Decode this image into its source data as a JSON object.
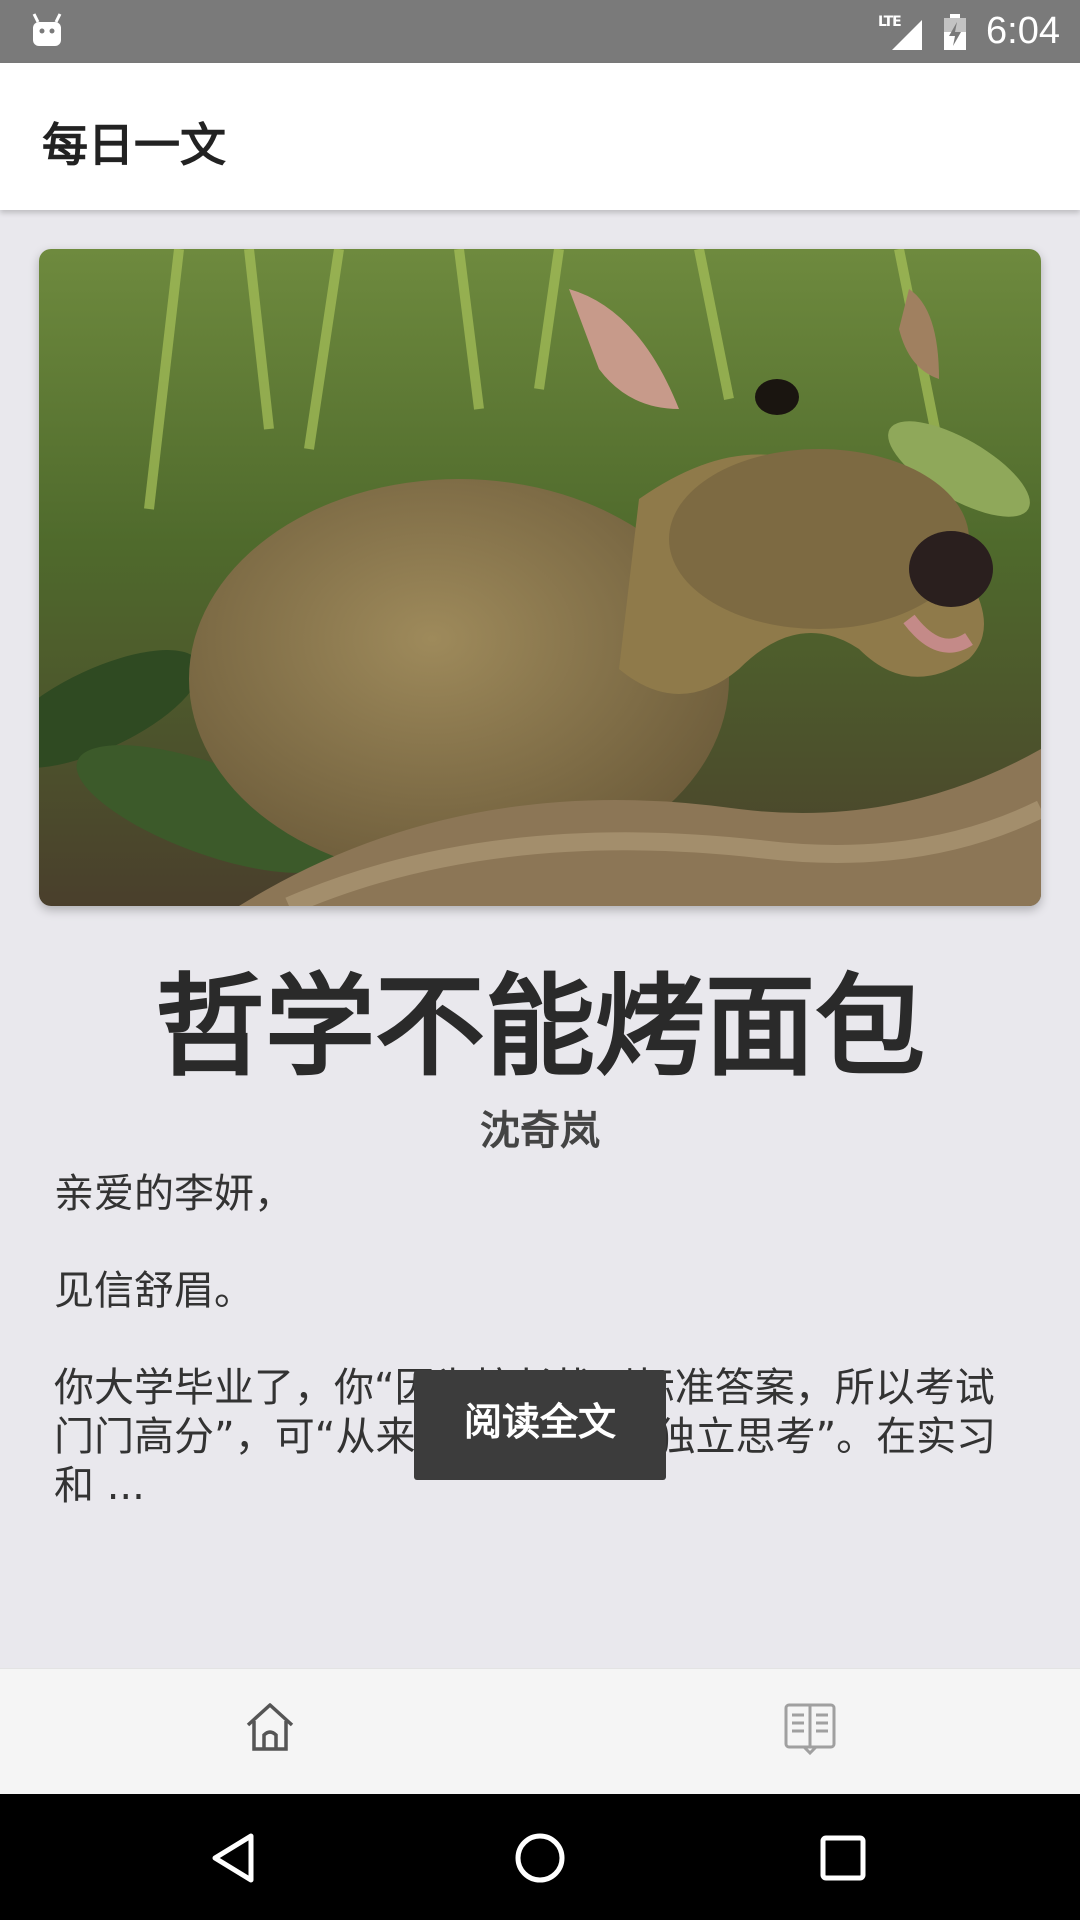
{
  "status_bar": {
    "left_icon": "android-icon",
    "network": "LTE",
    "signal_icon": "signal-icon",
    "battery_icon": "battery-charging-icon",
    "time": "6:04"
  },
  "app_bar": {
    "title": "每日一文"
  },
  "article": {
    "image_alt": "hero-image",
    "title": "哲学不能烤面包",
    "author": "沈奇岚",
    "excerpt": [
      "亲爱的李妍，",
      "见信舒眉。",
      "你大学毕业了，你“因为擅长找到标准答案，所以考试门门高分”，可“从来不知道什么叫独立思考”。在实习和 ..."
    ],
    "read_button": "阅读全文"
  },
  "tab_bar": {
    "items": [
      {
        "icon": "home-icon"
      },
      {
        "icon": "book-icon"
      }
    ]
  },
  "nav_bar": {
    "back_icon": "back-icon",
    "home_icon": "home-circle-icon",
    "recents_icon": "recents-icon"
  },
  "colors": {
    "status_bar": "#7A7A7A",
    "background": "#E9E8ED",
    "button": "#3C3C3C",
    "nav_bar": "#000000"
  }
}
